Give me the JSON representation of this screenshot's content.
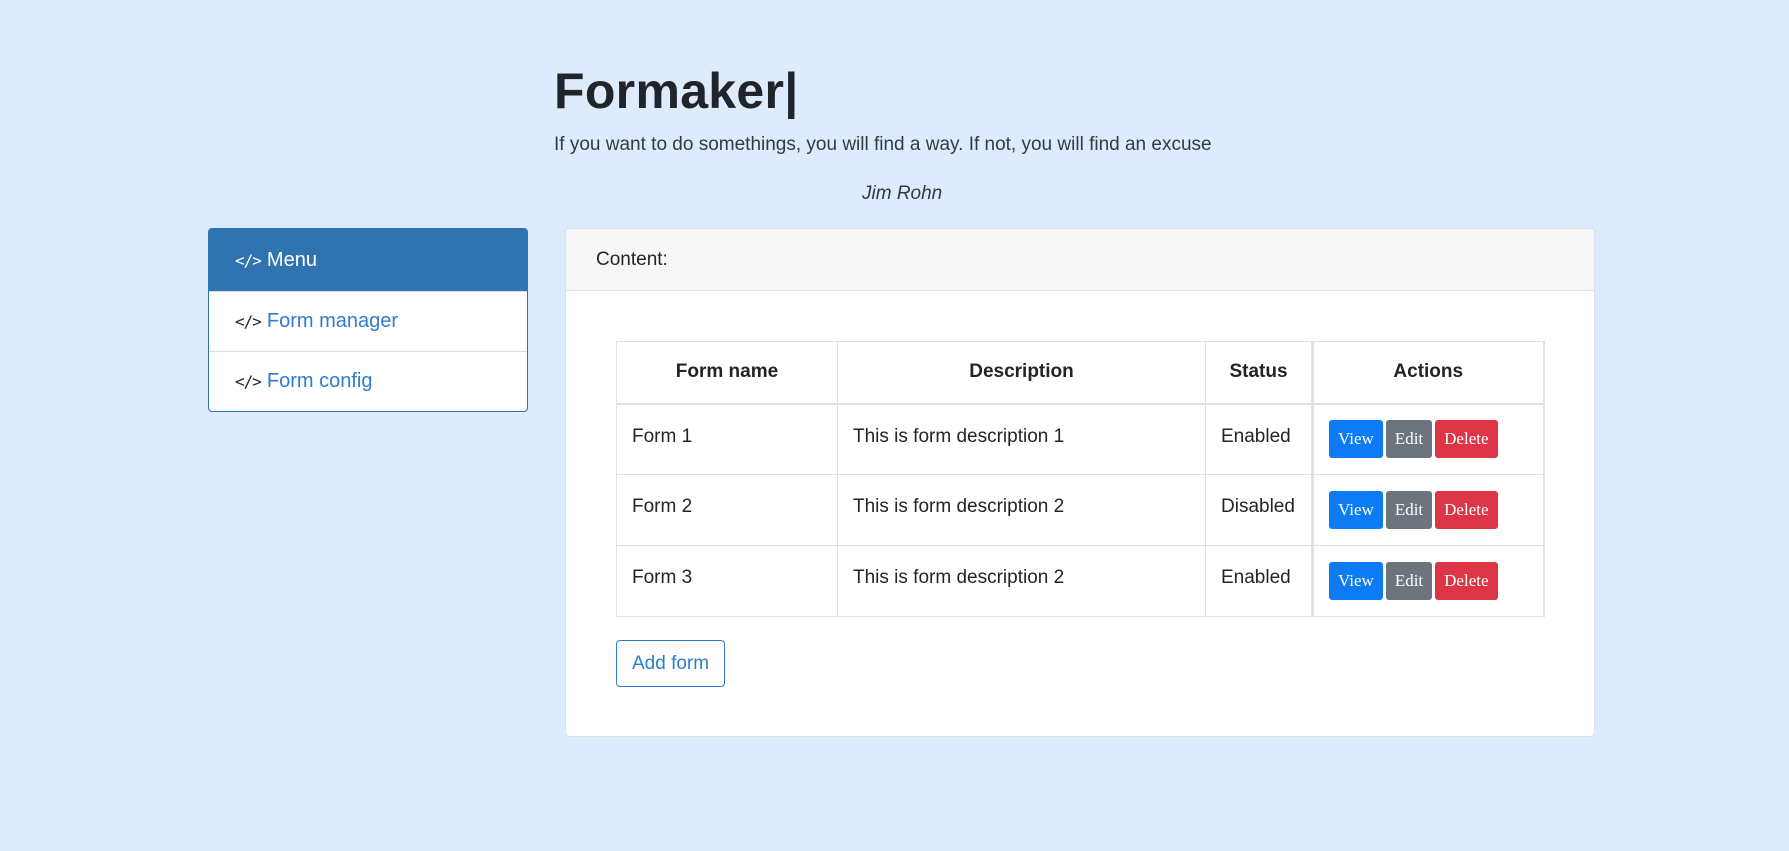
{
  "header": {
    "title": "Formaker|",
    "tagline": "If you want to do somethings, you will find a way. If not, you will find an excuse",
    "author": "Jim Rohn"
  },
  "menu": {
    "icon_glyph": "</>",
    "icon_name": "code-icon",
    "items": [
      {
        "label": "Menu",
        "active": true
      },
      {
        "label": "Form manager",
        "active": false
      },
      {
        "label": "Form config",
        "active": false
      }
    ]
  },
  "content": {
    "header_label": "Content:",
    "table": {
      "columns": [
        "Form name",
        "Description",
        "Status",
        "Actions"
      ],
      "rows": [
        {
          "name": "Form 1",
          "description": "This is form description 1",
          "status": "Enabled"
        },
        {
          "name": "Form 2",
          "description": "This is form description 2",
          "status": "Disabled"
        },
        {
          "name": "Form 3",
          "description": "This is form description 2",
          "status": "Enabled"
        }
      ],
      "actions": {
        "view_label": "View",
        "edit_label": "Edit",
        "delete_label": "Delete"
      }
    },
    "add_button_label": "Add form"
  },
  "colors": {
    "page_background": "#deebfd",
    "menu_active": "#2f74b0",
    "link": "#2f7ccf",
    "view_button": "#0d7bf3",
    "edit_button": "#6c757d",
    "delete_button": "#dc3545"
  }
}
